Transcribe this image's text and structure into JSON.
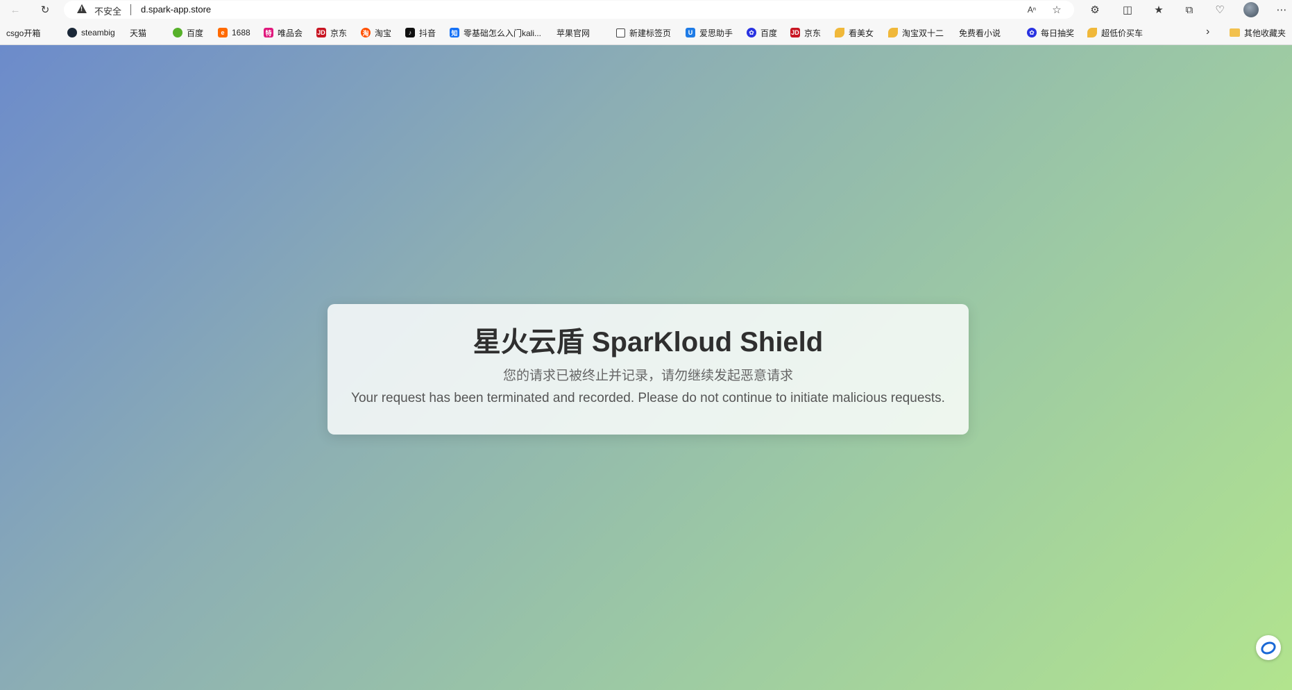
{
  "browser": {
    "address_bar": {
      "security_label": "不安全",
      "url": "d.spark-app.store"
    },
    "toolbar_icons": [
      "back-icon",
      "refresh-icon",
      "read-aloud-icon",
      "favorite-star-icon",
      "extensions-icon",
      "split-screen-icon",
      "favorites-icon",
      "collections-icon",
      "browser-essentials-icon",
      "profile-avatar",
      "more-icon"
    ],
    "bookmarks": [
      {
        "label": "csgo开箱",
        "icon": "page"
      },
      {
        "label": "steambig",
        "icon": "steam"
      },
      {
        "label": "天猫",
        "icon": "page"
      },
      {
        "label": "百度",
        "icon": "baidu-g"
      },
      {
        "label": "1688",
        "icon": "ali"
      },
      {
        "label": "唯品会",
        "icon": "vip"
      },
      {
        "label": "京东",
        "icon": "jd"
      },
      {
        "label": "淘宝",
        "icon": "taobao"
      },
      {
        "label": "抖音",
        "icon": "douyin"
      },
      {
        "label": "零基础怎么入门kali...",
        "icon": "zhi"
      },
      {
        "label": "苹果官网",
        "icon": "page"
      },
      {
        "label": "新建标签页",
        "icon": "newtab"
      },
      {
        "label": "爱思助手",
        "icon": "i4"
      },
      {
        "label": "百度",
        "icon": "baidu"
      },
      {
        "label": "京东",
        "icon": "jd"
      },
      {
        "label": "看美女",
        "icon": "leaf"
      },
      {
        "label": "淘宝双十二",
        "icon": "leaf"
      },
      {
        "label": "免费看小说",
        "icon": "page"
      },
      {
        "label": "每日抽奖",
        "icon": "baidu"
      },
      {
        "label": "超低价买车",
        "icon": "leaf"
      }
    ],
    "other_bookmarks_label": "其他收藏夹"
  },
  "page": {
    "title": "星火云盾 SparKloud Shield",
    "message_zh": "您的请求已被终止并记录，请勿继续发起恶意请求",
    "message_en": "Your request has been terminated and recorded. Please do not continue to initiate malicious requests."
  }
}
